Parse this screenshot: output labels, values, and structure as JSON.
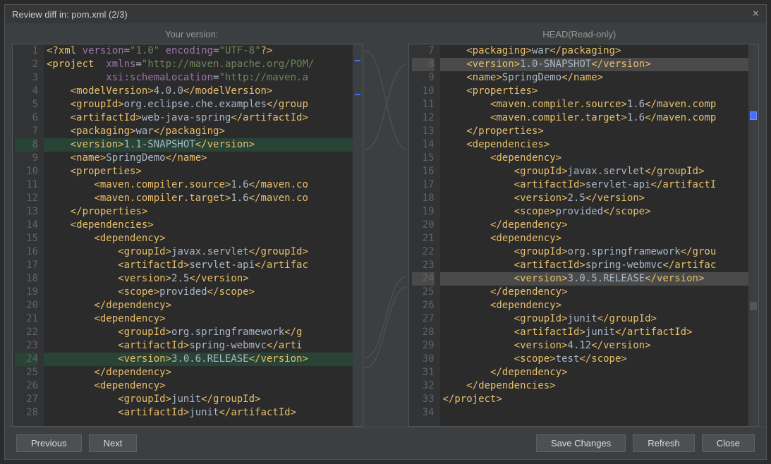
{
  "title": "Review diff in: pom.xml (2/3)",
  "header_left": "Your version:",
  "header_right": "HEAD(Read-only)",
  "buttons": {
    "previous": "Previous",
    "next": "Next",
    "save": "Save Changes",
    "refresh": "Refresh",
    "close": "Close"
  },
  "left_start_line": 1,
  "right_start_line": 7,
  "left_lines": [
    {
      "n": 1,
      "hl": "",
      "seg": [
        [
          "t-tag",
          "<?xml "
        ],
        [
          "t-attr",
          "version"
        ],
        [
          "",
          "="
        ],
        [
          "t-str",
          "\"1.0\""
        ],
        [
          "",
          " "
        ],
        [
          "t-attr",
          "encoding"
        ],
        [
          "",
          "="
        ],
        [
          "t-str",
          "\"UTF-8\""
        ],
        [
          "t-tag",
          "?>"
        ]
      ]
    },
    {
      "n": 2,
      "hl": "",
      "seg": [
        [
          "t-tag",
          "<project  "
        ],
        [
          "t-attr",
          "xmlns"
        ],
        [
          "",
          "="
        ],
        [
          "t-str",
          "\"http://maven.apache.org/POM/"
        ]
      ]
    },
    {
      "n": 3,
      "hl": "",
      "seg": [
        [
          "",
          "          "
        ],
        [
          "t-attr",
          "xsi:schemaLocation"
        ],
        [
          "",
          "="
        ],
        [
          "t-str",
          "\"http://maven.a"
        ]
      ]
    },
    {
      "n": 4,
      "hl": "",
      "seg": [
        [
          "",
          "    "
        ],
        [
          "t-tag",
          "<modelVersion>"
        ],
        [
          "",
          "4.0.0"
        ],
        [
          "t-tag",
          "</modelVersion>"
        ]
      ]
    },
    {
      "n": 5,
      "hl": "",
      "seg": [
        [
          "",
          "    "
        ],
        [
          "t-tag",
          "<groupId>"
        ],
        [
          "",
          "org.eclipse.che.examples"
        ],
        [
          "t-tag",
          "</group"
        ]
      ]
    },
    {
      "n": 6,
      "hl": "",
      "seg": [
        [
          "",
          "    "
        ],
        [
          "t-tag",
          "<artifactId>"
        ],
        [
          "",
          "web-java-spring"
        ],
        [
          "t-tag",
          "</artifactId>"
        ]
      ]
    },
    {
      "n": 7,
      "hl": "",
      "seg": [
        [
          "",
          "    "
        ],
        [
          "t-tag",
          "<packaging>"
        ],
        [
          "",
          "war"
        ],
        [
          "t-tag",
          "</packaging>"
        ]
      ]
    },
    {
      "n": 8,
      "hl": "hl-green",
      "seg": [
        [
          "",
          "    "
        ],
        [
          "t-tag",
          "<version>"
        ],
        [
          "",
          "1.1-SNAPSHOT"
        ],
        [
          "t-tag",
          "</version>"
        ]
      ]
    },
    {
      "n": 9,
      "hl": "",
      "seg": [
        [
          "",
          "    "
        ],
        [
          "t-tag",
          "<name>"
        ],
        [
          "",
          "SpringDemo"
        ],
        [
          "t-tag",
          "</name>"
        ]
      ]
    },
    {
      "n": 10,
      "hl": "",
      "seg": [
        [
          "",
          "    "
        ],
        [
          "t-tag",
          "<properties>"
        ]
      ]
    },
    {
      "n": 11,
      "hl": "",
      "seg": [
        [
          "",
          "        "
        ],
        [
          "t-tag",
          "<maven.compiler.source>"
        ],
        [
          "",
          "1.6"
        ],
        [
          "t-tag",
          "</maven.co"
        ]
      ]
    },
    {
      "n": 12,
      "hl": "",
      "seg": [
        [
          "",
          "        "
        ],
        [
          "t-tag",
          "<maven.compiler.target>"
        ],
        [
          "",
          "1.6"
        ],
        [
          "t-tag",
          "</maven.co"
        ]
      ]
    },
    {
      "n": 13,
      "hl": "",
      "seg": [
        [
          "",
          "    "
        ],
        [
          "t-tag",
          "</properties>"
        ]
      ]
    },
    {
      "n": 14,
      "hl": "",
      "seg": [
        [
          "",
          "    "
        ],
        [
          "t-tag",
          "<dependencies>"
        ]
      ]
    },
    {
      "n": 15,
      "hl": "",
      "seg": [
        [
          "",
          "        "
        ],
        [
          "t-tag",
          "<dependency>"
        ]
      ]
    },
    {
      "n": 16,
      "hl": "",
      "seg": [
        [
          "",
          "            "
        ],
        [
          "t-tag",
          "<groupId>"
        ],
        [
          "",
          "javax.servlet"
        ],
        [
          "t-tag",
          "</groupId>"
        ]
      ]
    },
    {
      "n": 17,
      "hl": "",
      "seg": [
        [
          "",
          "            "
        ],
        [
          "t-tag",
          "<artifactId>"
        ],
        [
          "",
          "servlet-api"
        ],
        [
          "t-tag",
          "</artifac"
        ]
      ]
    },
    {
      "n": 18,
      "hl": "",
      "seg": [
        [
          "",
          "            "
        ],
        [
          "t-tag",
          "<version>"
        ],
        [
          "",
          "2.5"
        ],
        [
          "t-tag",
          "</version>"
        ]
      ]
    },
    {
      "n": 19,
      "hl": "",
      "seg": [
        [
          "",
          "            "
        ],
        [
          "t-tag",
          "<scope>"
        ],
        [
          "",
          "provided"
        ],
        [
          "t-tag",
          "</scope>"
        ]
      ]
    },
    {
      "n": 20,
      "hl": "",
      "seg": [
        [
          "",
          "        "
        ],
        [
          "t-tag",
          "</dependency>"
        ]
      ]
    },
    {
      "n": 21,
      "hl": "",
      "seg": [
        [
          "",
          "        "
        ],
        [
          "t-tag",
          "<dependency>"
        ]
      ]
    },
    {
      "n": 22,
      "hl": "",
      "seg": [
        [
          "",
          "            "
        ],
        [
          "t-tag",
          "<groupId>"
        ],
        [
          "",
          "org.springframework"
        ],
        [
          "t-tag",
          "</g"
        ]
      ]
    },
    {
      "n": 23,
      "hl": "",
      "seg": [
        [
          "",
          "            "
        ],
        [
          "t-tag",
          "<artifactId>"
        ],
        [
          "",
          "spring-webmvc"
        ],
        [
          "t-tag",
          "</arti"
        ]
      ]
    },
    {
      "n": 24,
      "hl": "hl-green",
      "seg": [
        [
          "",
          "            "
        ],
        [
          "t-tag",
          "<version>"
        ],
        [
          "",
          "3.0.6.RELEASE"
        ],
        [
          "t-tag",
          "</version>"
        ]
      ]
    },
    {
      "n": 25,
      "hl": "",
      "seg": [
        [
          "",
          "        "
        ],
        [
          "t-tag",
          "</dependency>"
        ]
      ]
    },
    {
      "n": 26,
      "hl": "",
      "seg": [
        [
          "",
          "        "
        ],
        [
          "t-tag",
          "<dependency>"
        ]
      ]
    },
    {
      "n": 27,
      "hl": "",
      "seg": [
        [
          "",
          "            "
        ],
        [
          "t-tag",
          "<groupId>"
        ],
        [
          "",
          "junit"
        ],
        [
          "t-tag",
          "</groupId>"
        ]
      ]
    },
    {
      "n": 28,
      "hl": "",
      "seg": [
        [
          "",
          "            "
        ],
        [
          "t-tag",
          "<artifactId>"
        ],
        [
          "",
          "junit"
        ],
        [
          "t-tag",
          "</artifactId>"
        ]
      ]
    }
  ],
  "right_lines": [
    {
      "n": 7,
      "hl": "",
      "seg": [
        [
          "",
          "    "
        ],
        [
          "t-tag",
          "<packaging>"
        ],
        [
          "",
          "war"
        ],
        [
          "t-tag",
          "</packaging>"
        ]
      ]
    },
    {
      "n": 8,
      "hl": "hl-grey",
      "seg": [
        [
          "",
          "    "
        ],
        [
          "t-tag",
          "<version>"
        ],
        [
          "",
          "1.0-SNAPSHOT"
        ],
        [
          "t-tag",
          "</version>"
        ]
      ]
    },
    {
      "n": 9,
      "hl": "",
      "seg": [
        [
          "",
          "    "
        ],
        [
          "t-tag",
          "<name>"
        ],
        [
          "",
          "SpringDemo"
        ],
        [
          "t-tag",
          "</name>"
        ]
      ]
    },
    {
      "n": 10,
      "hl": "",
      "seg": [
        [
          "",
          "    "
        ],
        [
          "t-tag",
          "<properties>"
        ]
      ]
    },
    {
      "n": 11,
      "hl": "",
      "seg": [
        [
          "",
          "        "
        ],
        [
          "t-tag",
          "<maven.compiler.source>"
        ],
        [
          "",
          "1.6"
        ],
        [
          "t-tag",
          "</maven.comp"
        ]
      ]
    },
    {
      "n": 12,
      "hl": "",
      "seg": [
        [
          "",
          "        "
        ],
        [
          "t-tag",
          "<maven.compiler.target>"
        ],
        [
          "",
          "1.6"
        ],
        [
          "t-tag",
          "</maven.comp"
        ]
      ]
    },
    {
      "n": 13,
      "hl": "",
      "seg": [
        [
          "",
          "    "
        ],
        [
          "t-tag",
          "</properties>"
        ]
      ]
    },
    {
      "n": 14,
      "hl": "",
      "seg": [
        [
          "",
          "    "
        ],
        [
          "t-tag",
          "<dependencies>"
        ]
      ]
    },
    {
      "n": 15,
      "hl": "",
      "seg": [
        [
          "",
          "        "
        ],
        [
          "t-tag",
          "<dependency>"
        ]
      ]
    },
    {
      "n": 16,
      "hl": "",
      "seg": [
        [
          "",
          "            "
        ],
        [
          "t-tag",
          "<groupId>"
        ],
        [
          "",
          "javax.servlet"
        ],
        [
          "t-tag",
          "</groupId>"
        ]
      ]
    },
    {
      "n": 17,
      "hl": "",
      "seg": [
        [
          "",
          "            "
        ],
        [
          "t-tag",
          "<artifactId>"
        ],
        [
          "",
          "servlet-api"
        ],
        [
          "t-tag",
          "</artifactI"
        ]
      ]
    },
    {
      "n": 18,
      "hl": "",
      "seg": [
        [
          "",
          "            "
        ],
        [
          "t-tag",
          "<version>"
        ],
        [
          "",
          "2.5"
        ],
        [
          "t-tag",
          "</version>"
        ]
      ]
    },
    {
      "n": 19,
      "hl": "",
      "seg": [
        [
          "",
          "            "
        ],
        [
          "t-tag",
          "<scope>"
        ],
        [
          "",
          "provided"
        ],
        [
          "t-tag",
          "</scope>"
        ]
      ]
    },
    {
      "n": 20,
      "hl": "",
      "seg": [
        [
          "",
          "        "
        ],
        [
          "t-tag",
          "</dependency>"
        ]
      ]
    },
    {
      "n": 21,
      "hl": "",
      "seg": [
        [
          "",
          "        "
        ],
        [
          "t-tag",
          "<dependency>"
        ]
      ]
    },
    {
      "n": 22,
      "hl": "",
      "seg": [
        [
          "",
          "            "
        ],
        [
          "t-tag",
          "<groupId>"
        ],
        [
          "",
          "org.springframework"
        ],
        [
          "t-tag",
          "</grou"
        ]
      ]
    },
    {
      "n": 23,
      "hl": "",
      "seg": [
        [
          "",
          "            "
        ],
        [
          "t-tag",
          "<artifactId>"
        ],
        [
          "",
          "spring-webmvc"
        ],
        [
          "t-tag",
          "</artifac"
        ]
      ]
    },
    {
      "n": 24,
      "hl": "hl-grey",
      "seg": [
        [
          "",
          "            "
        ],
        [
          "t-tag",
          "<version>"
        ],
        [
          "",
          "3.0.5.RELEASE"
        ],
        [
          "t-tag",
          "</version>"
        ]
      ]
    },
    {
      "n": 25,
      "hl": "",
      "seg": [
        [
          "",
          "        "
        ],
        [
          "t-tag",
          "</dependency>"
        ]
      ]
    },
    {
      "n": 26,
      "hl": "",
      "seg": [
        [
          "",
          "        "
        ],
        [
          "t-tag",
          "<dependency>"
        ]
      ]
    },
    {
      "n": 27,
      "hl": "",
      "seg": [
        [
          "",
          "            "
        ],
        [
          "t-tag",
          "<groupId>"
        ],
        [
          "",
          "junit"
        ],
        [
          "t-tag",
          "</groupId>"
        ]
      ]
    },
    {
      "n": 28,
      "hl": "",
      "seg": [
        [
          "",
          "            "
        ],
        [
          "t-tag",
          "<artifactId>"
        ],
        [
          "",
          "junit"
        ],
        [
          "t-tag",
          "</artifactId>"
        ]
      ]
    },
    {
      "n": 29,
      "hl": "",
      "seg": [
        [
          "",
          "            "
        ],
        [
          "t-tag",
          "<version>"
        ],
        [
          "",
          "4.12"
        ],
        [
          "t-tag",
          "</version>"
        ]
      ]
    },
    {
      "n": 30,
      "hl": "",
      "seg": [
        [
          "",
          "            "
        ],
        [
          "t-tag",
          "<scope>"
        ],
        [
          "",
          "test"
        ],
        [
          "t-tag",
          "</scope>"
        ]
      ]
    },
    {
      "n": 31,
      "hl": "",
      "seg": [
        [
          "",
          "        "
        ],
        [
          "t-tag",
          "</dependency>"
        ]
      ]
    },
    {
      "n": 32,
      "hl": "",
      "seg": [
        [
          "",
          "    "
        ],
        [
          "t-tag",
          "</dependencies>"
        ]
      ]
    },
    {
      "n": 33,
      "hl": "",
      "seg": [
        [
          "t-tag",
          "</project>"
        ]
      ]
    },
    {
      "n": 34,
      "hl": "",
      "seg": [
        [
          "",
          ""
        ]
      ]
    }
  ]
}
